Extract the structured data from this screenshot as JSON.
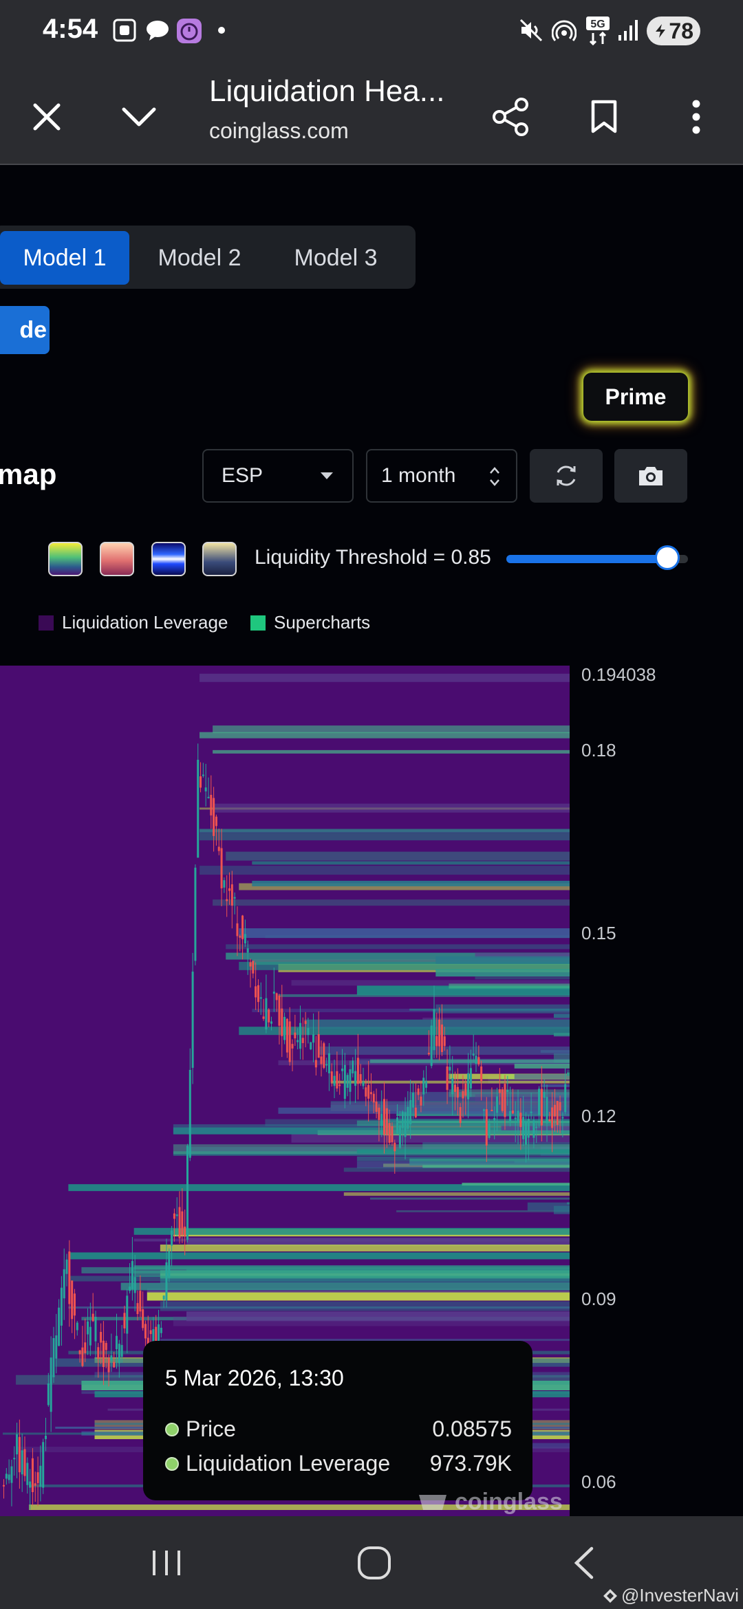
{
  "status_bar": {
    "time": "4:54",
    "battery": "78",
    "network": "5G",
    "icons": [
      "screenshot-icon",
      "chat-bubble-icon",
      "timer-app-icon",
      "notification-dot-icon",
      "mute-icon",
      "hotspot-icon",
      "5g-signal-icon",
      "cell-signal-icon",
      "battery-icon"
    ]
  },
  "browser": {
    "title": "Liquidation Hea...",
    "url": "coinglass.com",
    "buttons": [
      "close-icon",
      "chevron-down-icon",
      "share-icon",
      "bookmark-icon",
      "more-vert-icon"
    ]
  },
  "model_tabs": [
    {
      "label": "Model 1",
      "active": true
    },
    {
      "label": "Model 2",
      "active": false
    },
    {
      "label": "Model 3",
      "active": false
    }
  ],
  "trade_button": "de",
  "prime_button": "Prime",
  "heatmap_title": "map",
  "controls": {
    "symbol": "ESP",
    "period": "1 month",
    "refresh_icon": "refresh-icon",
    "camera_icon": "camera-icon"
  },
  "color_schemes": [
    "viridis",
    "pink",
    "blue",
    "gold"
  ],
  "threshold": {
    "label": "Liquidity Threshold = 0.85",
    "value": 0.85
  },
  "legend": [
    {
      "label": "Liquidation Leverage",
      "color": "#3a0a55"
    },
    {
      "label": "Supercharts",
      "color": "#1fc77e"
    }
  ],
  "chart_data": {
    "type": "heatmap",
    "ylim": [
      0.0545,
      0.194038
    ],
    "y_ticks": [
      "0.194038",
      "0.18",
      "0.15",
      "0.12",
      "0.09",
      "0.06"
    ],
    "background_color": "#4a0c70",
    "up_color": "#26a69a",
    "down_color": "#ef5350",
    "price_path": [
      0.058,
      0.066,
      0.061,
      0.062,
      0.082,
      0.095,
      0.081,
      0.086,
      0.079,
      0.083,
      0.094,
      0.082,
      0.084,
      0.104,
      0.1,
      0.176,
      0.17,
      0.158,
      0.152,
      0.146,
      0.137,
      0.138,
      0.132,
      0.135,
      0.131,
      0.128,
      0.125,
      0.128,
      0.124,
      0.12,
      0.116,
      0.121,
      0.124,
      0.136,
      0.127,
      0.122,
      0.131,
      0.118,
      0.124,
      0.121,
      0.117,
      0.122,
      0.12,
      0.123
    ]
  },
  "tooltip": {
    "date": "5 Mar 2026, 13:30",
    "rows": [
      {
        "label": "Price",
        "value": "0.08575"
      },
      {
        "label": "Liquidation Leverage",
        "value": "973.79K"
      }
    ]
  },
  "watermark": "coinglass",
  "nav": {
    "buttons": [
      "recent-apps-icon",
      "home-icon",
      "back-icon"
    ],
    "credit": "@InvesterNavi"
  }
}
